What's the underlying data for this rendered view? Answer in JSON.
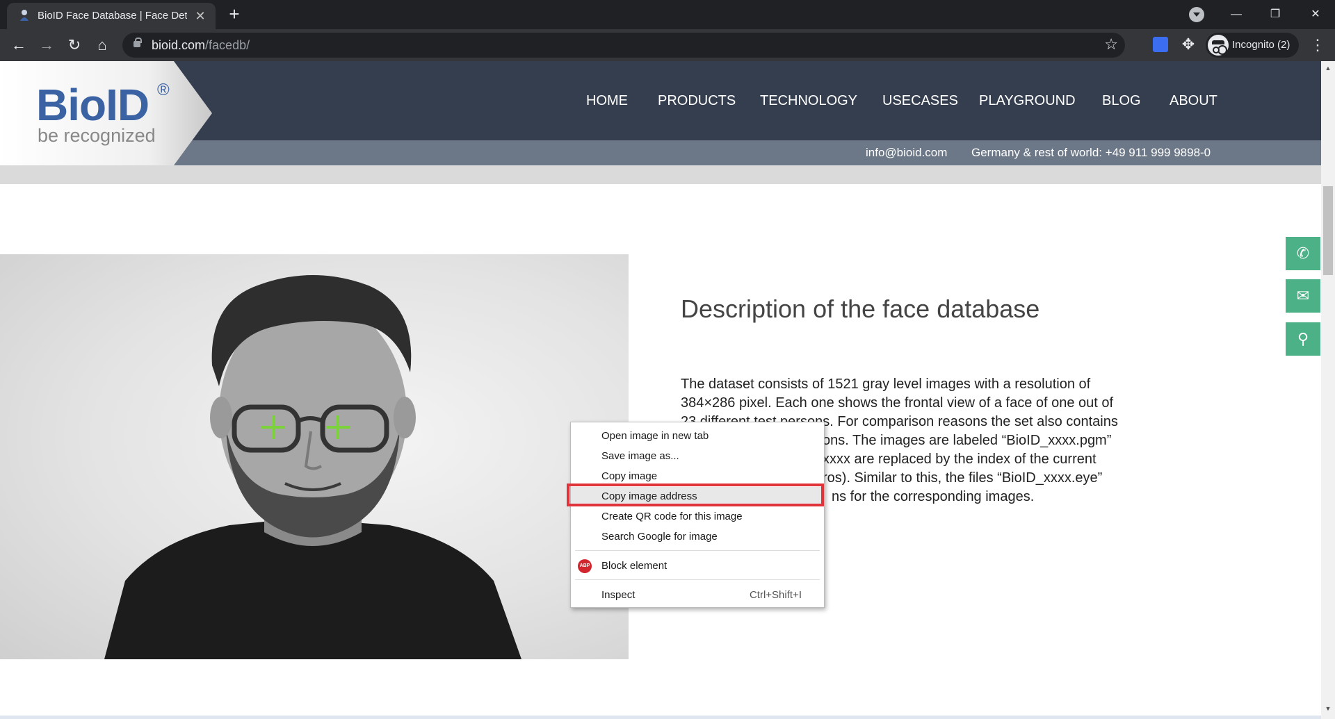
{
  "browser": {
    "tab_title": "BioID Face Database | Face Detec",
    "url_host": "bioid.com",
    "url_path": "/facedb/",
    "profile_label": "Incognito (2)"
  },
  "site": {
    "logo_word": "BioID",
    "logo_reg": "®",
    "logo_tagline": "be recognized",
    "nav": [
      "HOME",
      "PRODUCTS",
      "TECHNOLOGY",
      "USECASES",
      "PLAYGROUND",
      "BLOG",
      "ABOUT"
    ],
    "contact_email": "info@bioid.com",
    "contact_phone": "Germany & rest of world: +49 911 999 9898-0"
  },
  "content": {
    "heading": "Description of the face database",
    "paragraph_lines": [
      "The dataset consists of 1521 gray level images with a resolution of",
      "384×286 pixel. Each one shows the frontal view of a face of one out of",
      "23 different test persons. For comparison reasons the set also contains",
      "ons. The images are labeled “BioID_xxxx.pgm”",
      "xxxx are replaced by the index of the current",
      "ros). Similar to this, the files “BioID_xxxx.eye”",
      "ns for the corresponding images."
    ]
  },
  "side_buttons": [
    "phone-icon",
    "mail-icon",
    "location-icon"
  ],
  "context_menu": {
    "items": [
      {
        "label": "Open image in new tab"
      },
      {
        "label": "Save image as..."
      },
      {
        "label": "Copy image"
      },
      {
        "label": "Copy image address",
        "highlighted": true
      },
      {
        "label": "Create QR code for this image"
      },
      {
        "label": "Search Google for image"
      },
      {
        "label": "Block element",
        "icon": "ABP"
      },
      {
        "label": "Inspect",
        "shortcut": "Ctrl+Shift+I"
      }
    ]
  },
  "colors": {
    "header_bg": "#353e4f",
    "contact_bar": "#6c7787",
    "side_button": "#4cb187",
    "highlight_box": "#e0333a",
    "eye_marker": "#7cd23a"
  }
}
